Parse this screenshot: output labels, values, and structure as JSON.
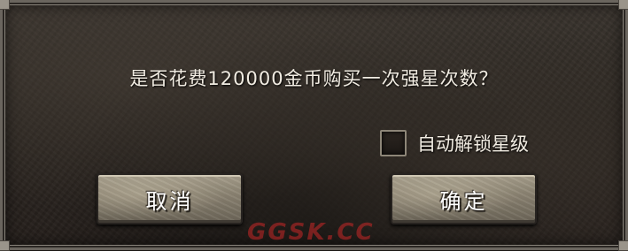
{
  "dialog": {
    "message": "是否花费120000金币购买一次强星次数？",
    "auto_unlock": {
      "label": "自动解锁星级",
      "checked": false
    },
    "buttons": {
      "cancel_label": "取消",
      "confirm_label": "确定"
    }
  },
  "watermark": {
    "text": "GGSK.CC"
  },
  "colors": {
    "text": "#f1ece2",
    "panel_bg": "#2c2722",
    "button_face": "#8b8372",
    "watermark": "#c82828"
  }
}
